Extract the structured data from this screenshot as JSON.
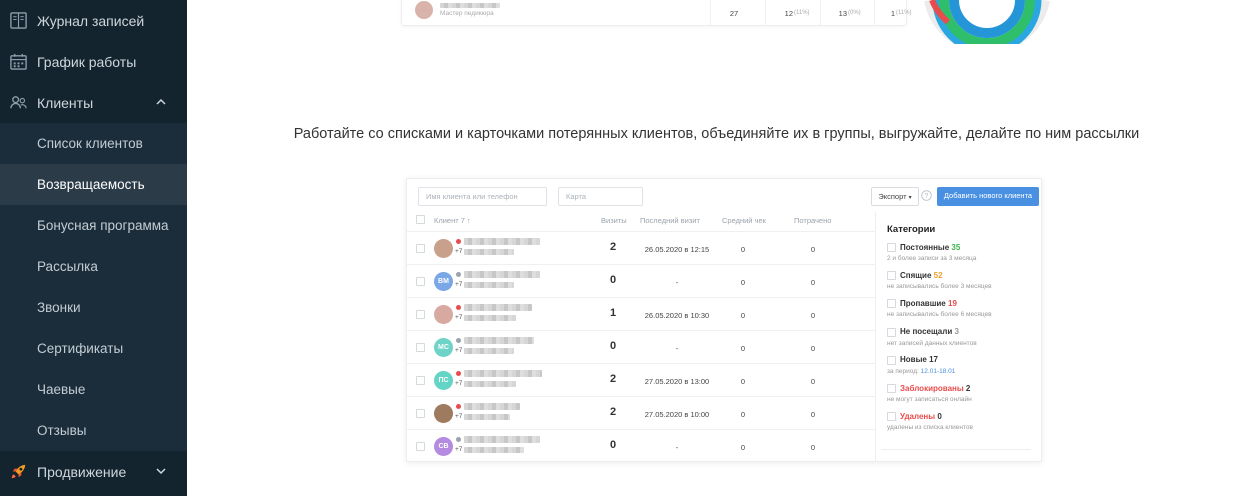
{
  "sidebar": {
    "items": [
      {
        "label": "Журнал записей",
        "icon": "journal-icon"
      },
      {
        "label": "График работы",
        "icon": "calendar-icon"
      },
      {
        "label": "Клиенты",
        "icon": "clients-icon"
      },
      {
        "label": "Список клиентов"
      },
      {
        "label": "Возвращаемость"
      },
      {
        "label": "Бонусная программа"
      },
      {
        "label": "Рассылка"
      },
      {
        "label": "Звонки"
      },
      {
        "label": "Сертификаты"
      },
      {
        "label": "Чаевые"
      },
      {
        "label": "Отзывы"
      },
      {
        "label": "Продвижение",
        "icon": "rocket-icon"
      }
    ]
  },
  "top_card": {
    "role": "Мастер педикюра",
    "values": [
      "27",
      "12",
      "(11%)",
      "13",
      "(0%)",
      "1",
      "(11%)"
    ]
  },
  "headline": "Работайте со списками и карточками потерянных клиентов, объединяйте их в группы, выгружайте, делайте по ним рассылки",
  "toolbar": {
    "search_placeholder": "Имя клиента или телефон",
    "card_placeholder": "Карта",
    "export_label": "Экспорт",
    "add_label": "Добавить нового клиента"
  },
  "table": {
    "headers": [
      "Клиент 7",
      "Визиты",
      "Последний визит",
      "Средний чек",
      "Потрачено"
    ],
    "rows": [
      {
        "initials": "",
        "phone_prefix": "+7",
        "visits": "2",
        "last": "26.05.2020 в 12:15",
        "avg": "0",
        "spent": "0",
        "dot": "red",
        "avatar_color": "#c9a08b"
      },
      {
        "initials": "ВМ",
        "phone_prefix": "+7",
        "visits": "0",
        "last": "-",
        "avg": "0",
        "spent": "0",
        "dot": "gray",
        "avatar_color": "#7aa7e6"
      },
      {
        "initials": "",
        "phone_prefix": "+7",
        "visits": "1",
        "last": "26.05.2020 в 10:30",
        "avg": "0",
        "spent": "0",
        "dot": "red",
        "avatar_color": "#d8a9a0"
      },
      {
        "initials": "МС",
        "phone_prefix": "+7",
        "visits": "0",
        "last": "-",
        "avg": "0",
        "spent": "0",
        "dot": "gray",
        "avatar_color": "#6fd3c8"
      },
      {
        "initials": "ПС",
        "phone_prefix": "+7",
        "visits": "2",
        "last": "27.05.2020 в 13:00",
        "avg": "0",
        "spent": "0",
        "dot": "red",
        "avatar_color": "#64d4c6"
      },
      {
        "initials": "",
        "phone_prefix": "+7",
        "visits": "2",
        "last": "27.05.2020 в 10:00",
        "avg": "0",
        "spent": "0",
        "dot": "red",
        "avatar_color": "#9e7a5f"
      },
      {
        "initials": "СВ",
        "phone_prefix": "+7",
        "visits": "0",
        "last": "-",
        "avg": "0",
        "spent": "0",
        "dot": "gray",
        "avatar_color": "#b48be0"
      }
    ]
  },
  "categories": {
    "title": "Категории",
    "items": [
      {
        "name": "Постоянные",
        "count": "35",
        "count_color": "#3bb54a",
        "sub": "2 и более записи за 3 месяца"
      },
      {
        "name": "Спящие",
        "count": "52",
        "count_color": "#f0a030",
        "sub": "не записывались более 3 месяцев"
      },
      {
        "name": "Пропавшие",
        "count": "19",
        "count_color": "#e84c4c",
        "sub": "не записывались более 6 месяцев"
      },
      {
        "name": "Не посещали",
        "count": "3",
        "count_color": "#999999",
        "sub": "нет записей данных клиентов"
      },
      {
        "name": "Новые",
        "count": "17",
        "count_color": "#333333",
        "sub": "за период:",
        "sub_link": "12.01-18.01"
      },
      {
        "name": "Заблокированы",
        "count": "2",
        "count_color": "#333333",
        "sub": "не могут записаться онлайн",
        "name_color": "#e84c4c"
      },
      {
        "name": "Удалены",
        "count": "0",
        "count_color": "#333333",
        "sub": "удалены из списка клиентов",
        "name_color": "#e84c4c"
      }
    ]
  },
  "colors": {
    "sidebar_bg": "#14242f",
    "sidebar_sub_bg": "#1b2d3a",
    "active_bg": "#2b3b48",
    "primary_button": "#4a90e2"
  }
}
